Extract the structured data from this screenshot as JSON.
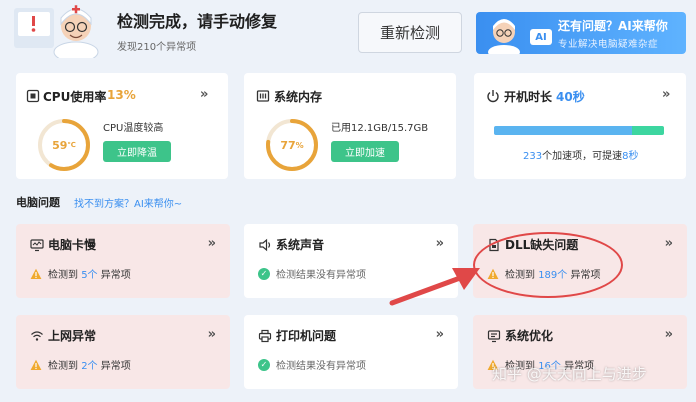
{
  "header": {
    "title": "检测完成，请手动修复",
    "subtitle": "发现210个异常项",
    "rescan_label": "重新检测"
  },
  "ai_banner": {
    "title": "还有问题？AI来帮你",
    "subtitle": "专业解决电脑疑难杂症",
    "badge": "AI"
  },
  "cpu_card": {
    "title": "CPU使用率",
    "usage": "13%",
    "temp": "59",
    "temp_unit": "℃",
    "temp_fraction": 0.59,
    "desc": "CPU温度较高",
    "button": "立即降温"
  },
  "memory_card": {
    "title": "系统内存",
    "percent": "77",
    "percent_unit": "%",
    "percent_fraction": 0.77,
    "desc": "已用12.1GB/15.7GB",
    "button": "立即加速"
  },
  "boot_card": {
    "title": "开机时长",
    "time": "40秒",
    "items_count": "233",
    "items_text": "个加速项，可提速",
    "speedup": "8秒",
    "bar_blue_fraction": 0.81,
    "bar_green_fraction": 0.19
  },
  "section": {
    "label": "电脑问题",
    "link": "找不到方案？AI来帮你~"
  },
  "issues": [
    {
      "name": "电脑卡慢",
      "icon": "monitor-icon",
      "state": "warn",
      "prefix": "检测到",
      "count": "5个",
      "suffix": "异常项"
    },
    {
      "name": "系统声音",
      "icon": "speaker-icon",
      "state": "ok",
      "ok_text": "检测结果没有异常项"
    },
    {
      "name": "DLL缺失问题",
      "icon": "file-icon",
      "state": "warn",
      "prefix": "检测到",
      "count": "189个",
      "suffix": "异常项"
    },
    {
      "name": "上网异常",
      "icon": "wifi-icon",
      "state": "warn",
      "prefix": "检测到",
      "count": "2个",
      "suffix": "异常项"
    },
    {
      "name": "打印机问题",
      "icon": "printer-icon",
      "state": "ok",
      "ok_text": "检测结果没有异常项"
    },
    {
      "name": "系统优化",
      "icon": "optimize-icon",
      "state": "warn",
      "prefix": "检测到",
      "count": "16个",
      "suffix": "异常项"
    }
  ],
  "watermark": "知乎 @天天向上与进步",
  "colors": {
    "accent_blue": "#3a8ff0",
    "green": "#3dc48a",
    "orange": "#e8a43a",
    "warn_bg": "#f8e7e7",
    "annotation_red": "#e04848"
  }
}
